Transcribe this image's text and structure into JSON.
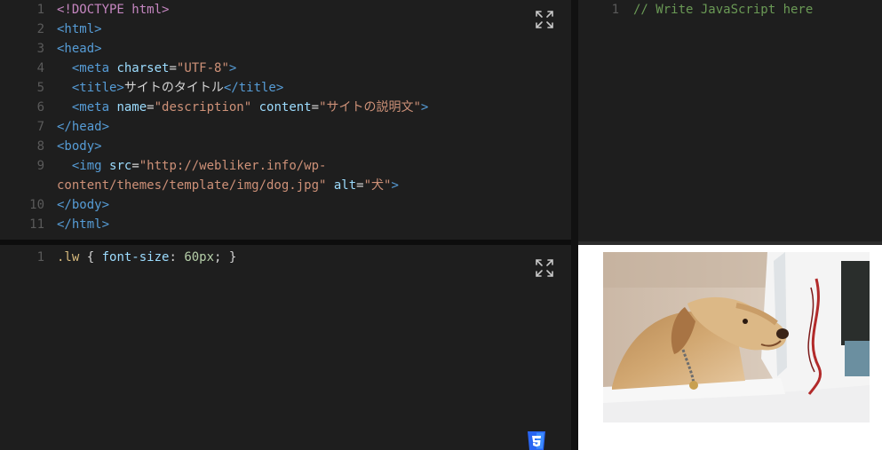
{
  "html_editor": {
    "lines": [
      {
        "n": "1",
        "parts": [
          {
            "t": "<!DOCTYPE html>",
            "c": "doc"
          }
        ]
      },
      {
        "n": "2",
        "parts": [
          {
            "t": "<html>",
            "c": "tag"
          }
        ]
      },
      {
        "n": "3",
        "parts": [
          {
            "t": "<head>",
            "c": "tag"
          }
        ]
      },
      {
        "n": "4",
        "parts": [
          {
            "t": "  <meta ",
            "c": "tag"
          },
          {
            "t": "charset",
            "c": "attr"
          },
          {
            "t": "=",
            "c": "text"
          },
          {
            "t": "\"UTF-8\"",
            "c": "str"
          },
          {
            "t": ">",
            "c": "tag"
          }
        ]
      },
      {
        "n": "5",
        "parts": [
          {
            "t": "  <title>",
            "c": "tag"
          },
          {
            "t": "サイトのタイトル",
            "c": "text"
          },
          {
            "t": "</title>",
            "c": "tag"
          }
        ]
      },
      {
        "n": "6",
        "parts": [
          {
            "t": "  <meta ",
            "c": "tag"
          },
          {
            "t": "name",
            "c": "attr"
          },
          {
            "t": "=",
            "c": "text"
          },
          {
            "t": "\"description\"",
            "c": "str"
          },
          {
            "t": " ",
            "c": "text"
          },
          {
            "t": "content",
            "c": "attr"
          },
          {
            "t": "=",
            "c": "text"
          },
          {
            "t": "\"サイトの説明文\"",
            "c": "str"
          },
          {
            "t": ">",
            "c": "tag"
          }
        ]
      },
      {
        "n": "7",
        "parts": [
          {
            "t": "</head>",
            "c": "tag"
          }
        ]
      },
      {
        "n": "8",
        "parts": [
          {
            "t": "<body>",
            "c": "tag"
          }
        ]
      },
      {
        "n": "9",
        "parts": [
          {
            "t": "  <img ",
            "c": "tag"
          },
          {
            "t": "src",
            "c": "attr"
          },
          {
            "t": "=",
            "c": "text"
          },
          {
            "t": "\"http://webliker.info/wp-",
            "c": "str"
          }
        ]
      },
      {
        "n": "",
        "parts": [
          {
            "t": "content/themes/template/img/dog.jpg\"",
            "c": "str"
          },
          {
            "t": " ",
            "c": "text"
          },
          {
            "t": "alt",
            "c": "attr"
          },
          {
            "t": "=",
            "c": "text"
          },
          {
            "t": "\"犬\"",
            "c": "str"
          },
          {
            "t": ">",
            "c": "tag"
          }
        ]
      },
      {
        "n": "10",
        "parts": [
          {
            "t": "</body>",
            "c": "tag"
          }
        ]
      },
      {
        "n": "11",
        "parts": [
          {
            "t": "</html>",
            "c": "tag"
          }
        ]
      }
    ]
  },
  "css_editor": {
    "lines": [
      {
        "n": "1",
        "parts": [
          {
            "t": ".lw",
            "c": "sel"
          },
          {
            "t": " { ",
            "c": "punc"
          },
          {
            "t": "font-size",
            "c": "prop"
          },
          {
            "t": ": ",
            "c": "punc"
          },
          {
            "t": "60px",
            "c": "num"
          },
          {
            "t": "; }",
            "c": "punc"
          }
        ]
      }
    ],
    "badge_icon": "css3-icon"
  },
  "js_editor": {
    "lines": [
      {
        "n": "1",
        "parts": [
          {
            "t": "// Write JavaScript here",
            "c": "com"
          }
        ]
      }
    ]
  },
  "preview": {
    "image_alt": "犬"
  },
  "icons": {
    "expand": "expand-icon"
  },
  "colors": {
    "editor_bg": "#1e1e1e",
    "tag": "#569cd6",
    "attr": "#9cdcfe",
    "string": "#ce9178",
    "doctype": "#c586c0",
    "comment": "#6a9955",
    "number": "#b5cea8",
    "selector": "#d7ba7d"
  }
}
